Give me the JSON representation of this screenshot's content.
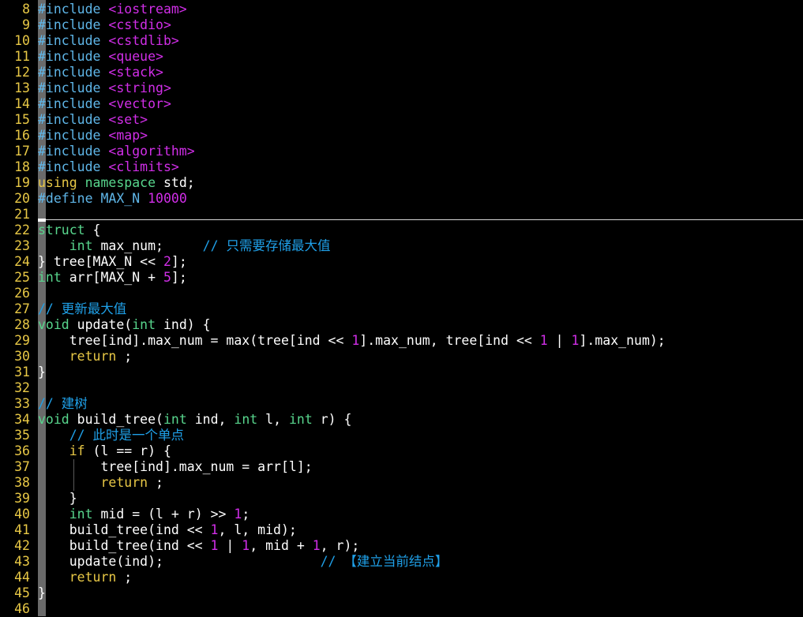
{
  "editor": {
    "lines": [
      {
        "n": "8",
        "tokens": [
          [
            "pre",
            "#include "
          ],
          [
            "str",
            "<iostream>"
          ]
        ]
      },
      {
        "n": "9",
        "tokens": [
          [
            "pre",
            "#include "
          ],
          [
            "str",
            "<cstdio>"
          ]
        ]
      },
      {
        "n": "10",
        "tokens": [
          [
            "pre",
            "#include "
          ],
          [
            "str",
            "<cstdlib>"
          ]
        ]
      },
      {
        "n": "11",
        "tokens": [
          [
            "pre",
            "#include "
          ],
          [
            "str",
            "<queue>"
          ]
        ]
      },
      {
        "n": "12",
        "tokens": [
          [
            "pre",
            "#include "
          ],
          [
            "str",
            "<stack>"
          ]
        ]
      },
      {
        "n": "13",
        "tokens": [
          [
            "pre",
            "#include "
          ],
          [
            "str",
            "<string>"
          ]
        ]
      },
      {
        "n": "14",
        "tokens": [
          [
            "pre",
            "#include "
          ],
          [
            "str",
            "<vector>"
          ]
        ]
      },
      {
        "n": "15",
        "tokens": [
          [
            "pre",
            "#include "
          ],
          [
            "str",
            "<set>"
          ]
        ]
      },
      {
        "n": "16",
        "tokens": [
          [
            "pre",
            "#include "
          ],
          [
            "str",
            "<map>"
          ]
        ]
      },
      {
        "n": "17",
        "tokens": [
          [
            "pre",
            "#include "
          ],
          [
            "str",
            "<algorithm>"
          ]
        ]
      },
      {
        "n": "18",
        "tokens": [
          [
            "pre",
            "#include "
          ],
          [
            "str",
            "<climits>"
          ]
        ]
      },
      {
        "n": "19",
        "tokens": [
          [
            "kw",
            "using"
          ],
          [
            "plain",
            " "
          ],
          [
            "type",
            "namespace"
          ],
          [
            "plain",
            " std;"
          ]
        ]
      },
      {
        "n": "20",
        "tokens": [
          [
            "pre",
            "#define MAX_N "
          ],
          [
            "num",
            "10000"
          ]
        ]
      },
      {
        "n": "21",
        "tokens": []
      },
      {
        "n": "22",
        "tokens": [
          [
            "type",
            "struct"
          ],
          [
            "plain",
            " {"
          ]
        ]
      },
      {
        "n": "23",
        "tokens": [
          [
            "plain",
            "    "
          ],
          [
            "type",
            "int"
          ],
          [
            "plain",
            " max_num;     "
          ],
          [
            "cmt",
            "// 只需要存储最大值"
          ]
        ]
      },
      {
        "n": "24",
        "tokens": [
          [
            "plain",
            "} tree[MAX_N << "
          ],
          [
            "num",
            "2"
          ],
          [
            "plain",
            "];"
          ]
        ]
      },
      {
        "n": "25",
        "tokens": [
          [
            "type",
            "int"
          ],
          [
            "plain",
            " arr[MAX_N + "
          ],
          [
            "num",
            "5"
          ],
          [
            "plain",
            "];"
          ]
        ]
      },
      {
        "n": "26",
        "tokens": []
      },
      {
        "n": "27",
        "tokens": [
          [
            "cmt",
            "// 更新最大值"
          ]
        ]
      },
      {
        "n": "28",
        "tokens": [
          [
            "type",
            "void"
          ],
          [
            "plain",
            " update("
          ],
          [
            "type",
            "int"
          ],
          [
            "plain",
            " ind) {"
          ]
        ]
      },
      {
        "n": "29",
        "tokens": [
          [
            "plain",
            "    tree[ind].max_num = max(tree[ind << "
          ],
          [
            "num",
            "1"
          ],
          [
            "plain",
            "].max_num, tree[ind << "
          ],
          [
            "num",
            "1"
          ],
          [
            "plain",
            " | "
          ],
          [
            "num",
            "1"
          ],
          [
            "plain",
            "].max_num);"
          ]
        ]
      },
      {
        "n": "30",
        "tokens": [
          [
            "plain",
            "    "
          ],
          [
            "kw",
            "return"
          ],
          [
            "plain",
            " ;"
          ]
        ]
      },
      {
        "n": "31",
        "tokens": [
          [
            "plain",
            "}"
          ]
        ]
      },
      {
        "n": "32",
        "tokens": []
      },
      {
        "n": "33",
        "tokens": [
          [
            "cmt",
            "// 建树"
          ]
        ]
      },
      {
        "n": "34",
        "tokens": [
          [
            "type",
            "void"
          ],
          [
            "plain",
            " build_tree("
          ],
          [
            "type",
            "int"
          ],
          [
            "plain",
            " ind, "
          ],
          [
            "type",
            "int"
          ],
          [
            "plain",
            " l, "
          ],
          [
            "type",
            "int"
          ],
          [
            "plain",
            " r) {"
          ]
        ]
      },
      {
        "n": "35",
        "tokens": [
          [
            "plain",
            "    "
          ],
          [
            "cmt",
            "// 此时是一个单点"
          ]
        ]
      },
      {
        "n": "36",
        "tokens": [
          [
            "plain",
            "    "
          ],
          [
            "kw",
            "if"
          ],
          [
            "plain",
            " (l == r) {"
          ]
        ]
      },
      {
        "n": "37",
        "tokens": [
          [
            "plain",
            "        tree[ind].max_num = arr[l];"
          ]
        ]
      },
      {
        "n": "38",
        "tokens": [
          [
            "plain",
            "        "
          ],
          [
            "kw",
            "return"
          ],
          [
            "plain",
            " ;"
          ]
        ]
      },
      {
        "n": "39",
        "tokens": [
          [
            "plain",
            "    }"
          ]
        ]
      },
      {
        "n": "40",
        "tokens": [
          [
            "plain",
            "    "
          ],
          [
            "type",
            "int"
          ],
          [
            "plain",
            " mid = (l + r) >> "
          ],
          [
            "num",
            "1"
          ],
          [
            "plain",
            ";"
          ]
        ]
      },
      {
        "n": "41",
        "tokens": [
          [
            "plain",
            "    build_tree(ind << "
          ],
          [
            "num",
            "1"
          ],
          [
            "plain",
            ", l, mid);"
          ]
        ]
      },
      {
        "n": "42",
        "tokens": [
          [
            "plain",
            "    build_tree(ind << "
          ],
          [
            "num",
            "1"
          ],
          [
            "plain",
            " | "
          ],
          [
            "num",
            "1"
          ],
          [
            "plain",
            ", mid + "
          ],
          [
            "num",
            "1"
          ],
          [
            "plain",
            ", r);"
          ]
        ]
      },
      {
        "n": "43",
        "tokens": [
          [
            "plain",
            "    update(ind);                    "
          ],
          [
            "cmt",
            "// 【建立当前结点】"
          ]
        ]
      },
      {
        "n": "44",
        "tokens": [
          [
            "plain",
            "    "
          ],
          [
            "kw",
            "return"
          ],
          [
            "plain",
            " ;"
          ]
        ]
      },
      {
        "n": "45",
        "tokens": [
          [
            "plain",
            "}"
          ]
        ]
      },
      {
        "n": "46",
        "tokens": []
      }
    ],
    "colors": {
      "background": "#000000",
      "line_number": "#e8c846",
      "preprocessor": "#5fb6e8",
      "keyword": "#e8c846",
      "type": "#58d68d",
      "string": "#d12ee8",
      "number": "#d12ee8",
      "comment": "#1fa0e8",
      "plain": "#ffffff"
    }
  }
}
